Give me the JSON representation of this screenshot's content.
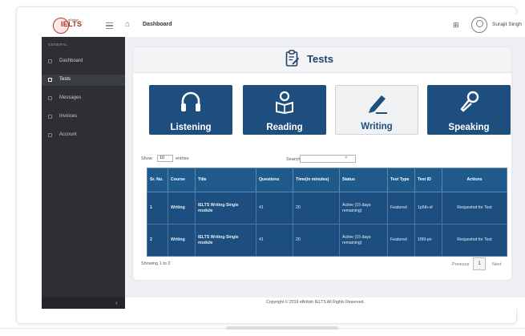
{
  "header": {
    "logo_text": "IELTS",
    "logo_sub": "eBritish",
    "breadcrumb": "Dashboard",
    "user_name": "Surajit Singh"
  },
  "sidebar": {
    "section": "GENERAL",
    "items": [
      {
        "label": "Dashboard",
        "active": false
      },
      {
        "label": "Tests",
        "active": true
      },
      {
        "label": "Messages",
        "active": false
      },
      {
        "label": "Invoices",
        "active": false
      },
      {
        "label": "Account",
        "active": false
      }
    ],
    "collapse_glyph": "‹"
  },
  "page": {
    "title": "Tests"
  },
  "tiles": [
    {
      "label": "Listening",
      "icon": "headphones-icon"
    },
    {
      "label": "Reading",
      "icon": "reading-icon"
    },
    {
      "label": "Writing",
      "icon": "writing-icon"
    },
    {
      "label": "Speaking",
      "icon": "microphone-icon"
    }
  ],
  "table_controls": {
    "show_label": "Show",
    "show_value": "10",
    "entries_label": "entries",
    "search_label": "Search:"
  },
  "table": {
    "columns": [
      "Sr. No.",
      "Course",
      "Title",
      "Questions",
      "Time(in minutes)",
      "Status",
      "Test Type",
      "Test ID",
      "Actions"
    ],
    "rows": [
      [
        "1",
        "Writing",
        "IELTS Writing Single module",
        "41",
        "20",
        "Active (15 days remaining)",
        "Featured",
        "1p5th-sf",
        "Requested for Test"
      ],
      [
        "2",
        "Writing",
        "IELTS Writing Single module",
        "41",
        "20",
        "Active (15 days remaining)",
        "Featured",
        "1f99-pn",
        "Requested for Test"
      ]
    ]
  },
  "pagination": {
    "showing": "Showing 1 to 2",
    "previous": "Previous",
    "page": "1",
    "next": "Next"
  },
  "footer": {
    "text": "Copyright © 2019 eBritish IELTS All Rights Reserved."
  },
  "colors": {
    "tile_blue": "#1d4e7d",
    "sidebar_dark": "#2d2f33",
    "table_header": "#1f5a8d"
  }
}
